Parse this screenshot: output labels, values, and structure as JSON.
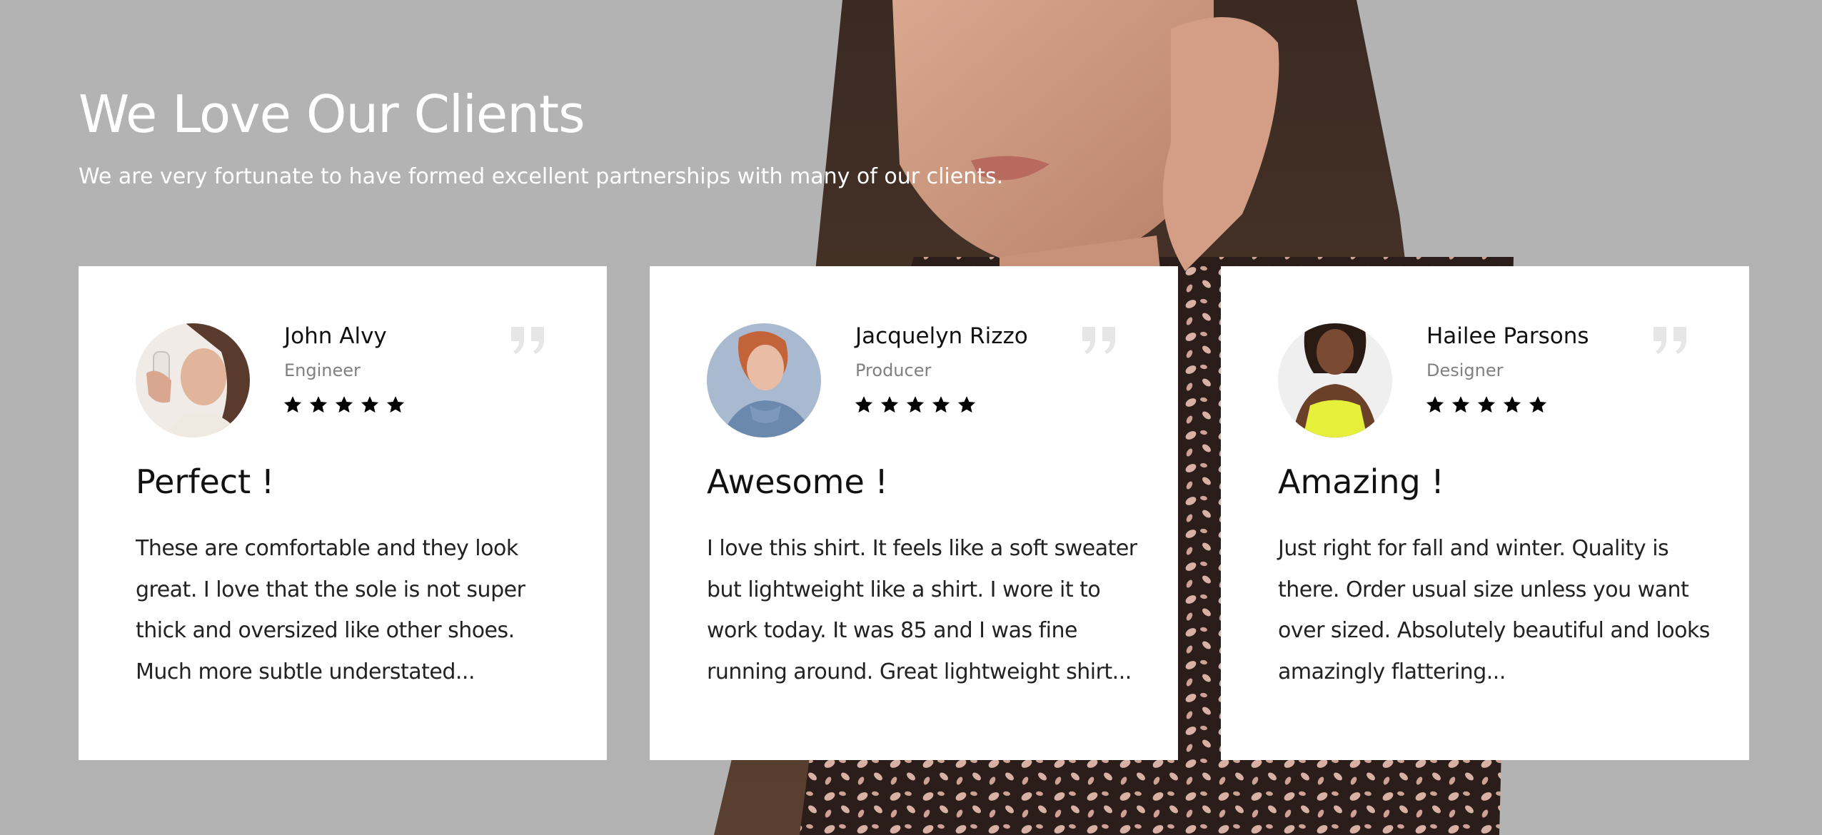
{
  "section": {
    "title": "We Love Our Clients",
    "subtitle": "We are very fortunate to have formed excellent partnerships with many of our clients."
  },
  "testimonials": [
    {
      "name": "John Alvy",
      "role": "Engineer",
      "rating": 5,
      "title": "Perfect !",
      "lines": [
        "These are comfortable and they look",
        "great. I love that the sole is not super",
        "thick and oversized like other shoes.",
        "Much more subtle understated..."
      ]
    },
    {
      "name": "Jacquelyn Rizzo",
      "role": "Producer",
      "rating": 5,
      "title": "Awesome !",
      "lines": [
        "I love this shirt. It feels like a soft sweater",
        "but lightweight like a shirt. I wore it to",
        "work today. It was 85 and I was fine",
        "running around. Great lightweight shirt..."
      ]
    },
    {
      "name": "Hailee Parsons",
      "role": "Designer",
      "rating": 5,
      "title": "Amazing !",
      "lines": [
        "Just right for fall and winter. Quality is",
        "there. Order usual size unless you want",
        "over sized. Absolutely beautiful and looks",
        "amazingly flattering..."
      ]
    }
  ],
  "icons": {
    "star": "star-icon",
    "quote": "quote-icon"
  },
  "colors": {
    "background": "#b3b3b3",
    "card": "#ffffff",
    "heading_text": "#ffffff",
    "star": "#000000",
    "quote_mark": "#e6e6e6",
    "role_text": "#808080"
  }
}
